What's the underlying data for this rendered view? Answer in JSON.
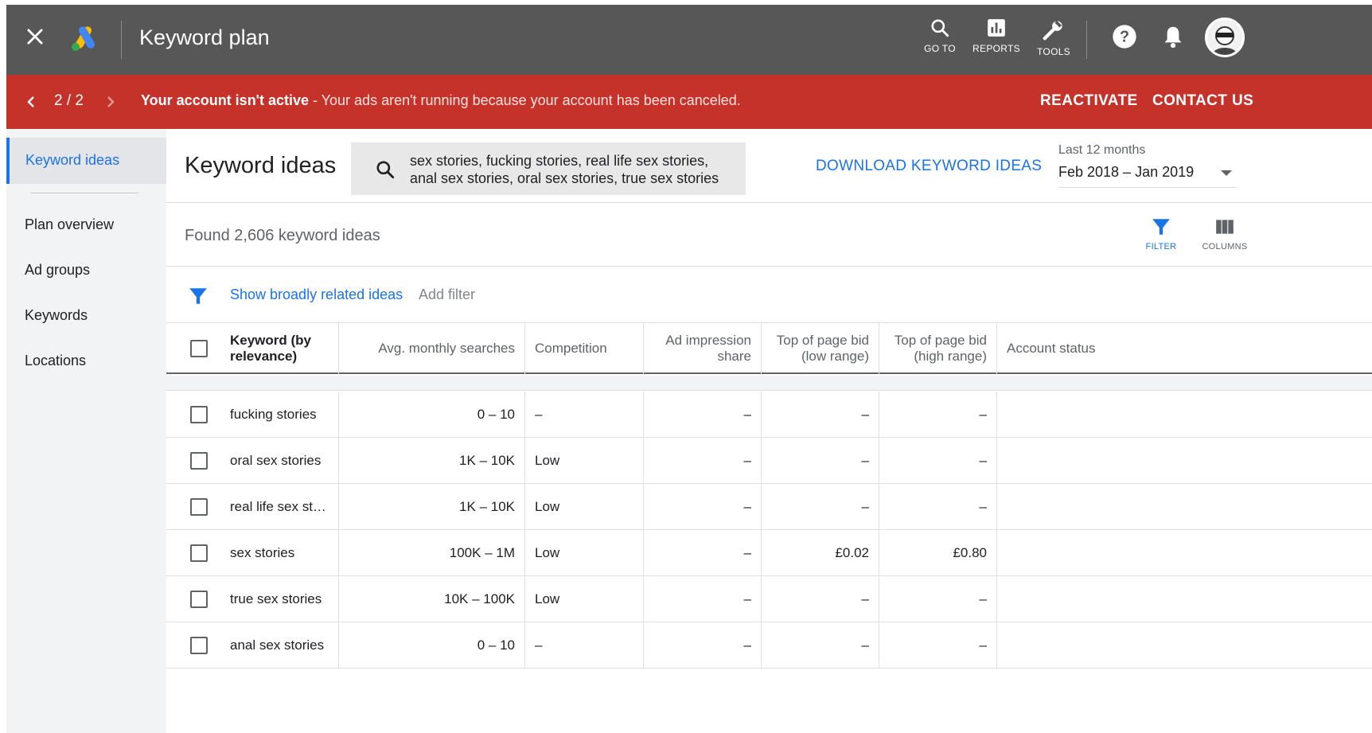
{
  "header": {
    "title": "Keyword plan",
    "tools": [
      {
        "label": "GO TO",
        "icon": "search-icon"
      },
      {
        "label": "REPORTS",
        "icon": "reports-icon"
      },
      {
        "label": "TOOLS",
        "icon": "wrench-icon"
      }
    ]
  },
  "alert": {
    "pager": "2 / 2",
    "message_bold": "Your account isn't active",
    "message_rest": " - Your ads aren't running because your account has been canceled.",
    "reactivate": "REACTIVATE",
    "contact": "CONTACT US"
  },
  "sidebar": {
    "active": "Keyword ideas",
    "items": [
      "Plan overview",
      "Ad groups",
      "Keywords",
      "Locations"
    ]
  },
  "main": {
    "title": "Keyword ideas",
    "search_query": "sex stories, fucking stories, real life sex stories, anal sex stories, oral sex stories, true sex stories",
    "download": "DOWNLOAD KEYWORD IDEAS",
    "range_label": "Last 12 months",
    "range_value": "Feb 2018 – Jan 2019",
    "found": "Found 2,606 keyword ideas",
    "filter_label": "FILTER",
    "columns_label": "COLUMNS",
    "broad": "Show broadly related ideas",
    "add_filter": "Add filter"
  },
  "table": {
    "headers": {
      "keyword": "Keyword (by relevance)",
      "searches": "Avg. monthly searches",
      "competition": "Competition",
      "impression": "Ad impression share",
      "bid_low": "Top of page bid (low range)",
      "bid_high": "Top of page bid (high range)",
      "status": "Account status"
    },
    "rows": [
      {
        "keyword": "fucking stories",
        "searches": "0 – 10",
        "competition": "–",
        "impression": "–",
        "bid_low": "–",
        "bid_high": "–"
      },
      {
        "keyword": "oral sex stories",
        "searches": "1K – 10K",
        "competition": "Low",
        "impression": "–",
        "bid_low": "–",
        "bid_high": "–"
      },
      {
        "keyword": "real life sex st…",
        "searches": "1K – 10K",
        "competition": "Low",
        "impression": "–",
        "bid_low": "–",
        "bid_high": "–"
      },
      {
        "keyword": "sex stories",
        "searches": "100K – 1M",
        "competition": "Low",
        "impression": "–",
        "bid_low": "£0.02",
        "bid_high": "£0.80"
      },
      {
        "keyword": "true sex stories",
        "searches": "10K – 100K",
        "competition": "Low",
        "impression": "–",
        "bid_low": "–",
        "bid_high": "–"
      },
      {
        "keyword": "anal sex stories",
        "searches": "0 – 10",
        "competition": "–",
        "impression": "–",
        "bid_low": "–",
        "bid_high": "–"
      }
    ]
  },
  "colors": {
    "topbar": "#575757",
    "alert": "#c5322a",
    "accent": "#1a73e8",
    "sidebar": "#f1f3f4"
  }
}
